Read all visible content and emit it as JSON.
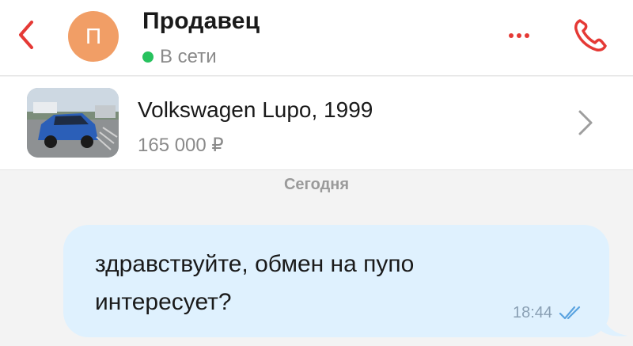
{
  "colors": {
    "accent": "#e53935",
    "online": "#27c25e",
    "avatar": "#f19e66",
    "bubble": "#dff1fe",
    "ticks": "#5aa3e0"
  },
  "header": {
    "avatar_letter": "П",
    "title": "Продавец",
    "status": "В сети",
    "icons": [
      "back-arrow",
      "more-dots",
      "phone"
    ]
  },
  "listing": {
    "title": "Volkswagen Lupo, 1999",
    "price": "165 000 ₽"
  },
  "chat": {
    "date_separator": "Сегодня",
    "messages": [
      {
        "text_line1": "здравствуйте, обмен на пупо",
        "text_line2": "интересует?",
        "time": "18:44",
        "status": "read"
      }
    ]
  }
}
